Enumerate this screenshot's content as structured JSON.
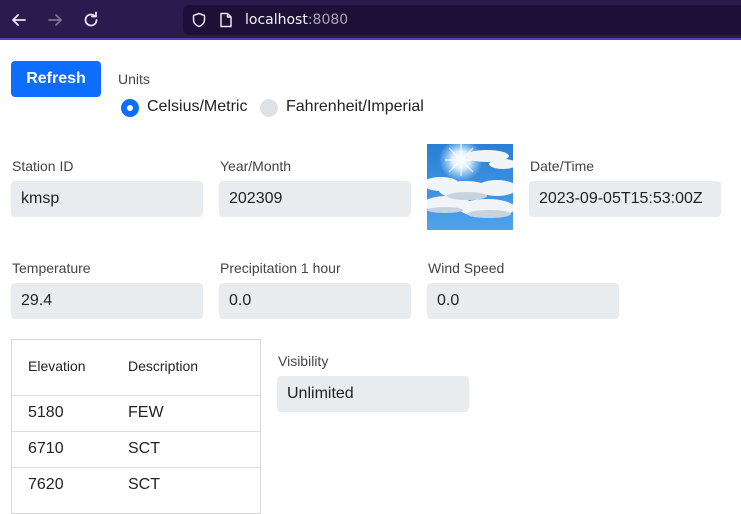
{
  "browser": {
    "url_host": "localhost",
    "url_port": ":8080"
  },
  "controls": {
    "refresh_label": "Refresh",
    "units_label": "Units",
    "unit_options": [
      {
        "label": "Celsius/Metric",
        "selected": true
      },
      {
        "label": "Fahrenheit/Imperial",
        "selected": false
      }
    ]
  },
  "fields": {
    "station_id": {
      "label": "Station ID",
      "value": "kmsp"
    },
    "year_month": {
      "label": "Year/Month",
      "value": "202309"
    },
    "date_time": {
      "label": "Date/Time",
      "value": "2023-09-05T15:53:00Z"
    },
    "temperature": {
      "label": "Temperature",
      "value": "29.4"
    },
    "precipitation": {
      "label": "Precipitation 1 hour",
      "value": "0.0"
    },
    "wind_speed": {
      "label": "Wind Speed",
      "value": "0.0"
    },
    "visibility": {
      "label": "Visibility",
      "value": "Unlimited"
    }
  },
  "weather_icon": "partly-sunny-sky-image",
  "clouds_table": {
    "headers": [
      "Elevation",
      "Description"
    ],
    "rows": [
      [
        "5180",
        "FEW"
      ],
      [
        "6710",
        "SCT"
      ],
      [
        "7620",
        "SCT"
      ]
    ]
  },
  "colors": {
    "accent": "#0d6efd",
    "field_bg": "#e9ecef",
    "toolbar_bg": "#2b1a4e"
  }
}
